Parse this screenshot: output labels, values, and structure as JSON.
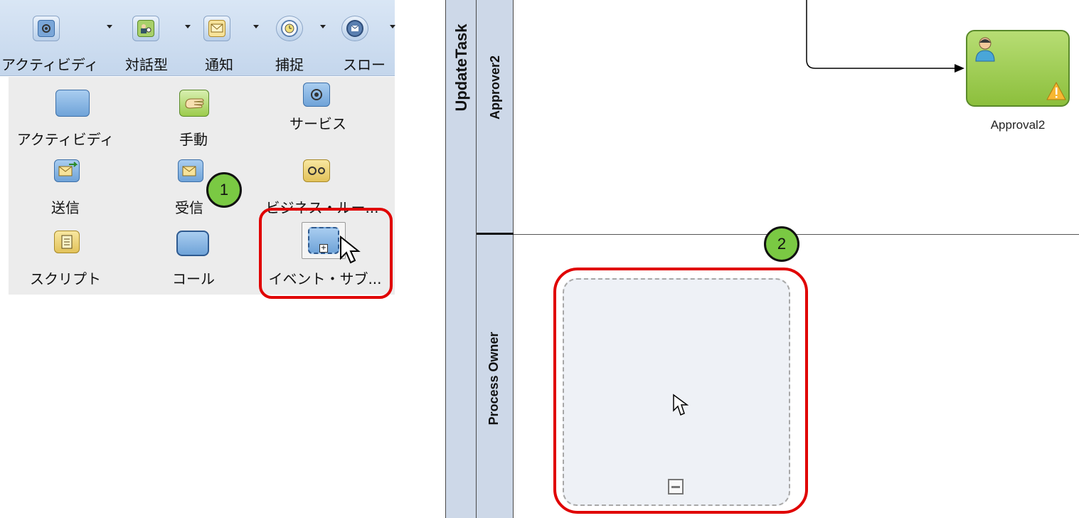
{
  "toolbar": {
    "categories": [
      {
        "label": "アクティビディ",
        "icon": "gear-icon"
      },
      {
        "label": "対話型",
        "icon": "people-icon"
      },
      {
        "label": "通知",
        "icon": "envelope-icon"
      },
      {
        "label": "捕捉",
        "icon": "clock-icon"
      },
      {
        "label": "スロー",
        "icon": "message-icon"
      }
    ]
  },
  "palette": {
    "items": [
      {
        "label": "アクティビディ",
        "icon": "activity-icon"
      },
      {
        "label": "手動",
        "icon": "hand-icon"
      },
      {
        "label": "サービス",
        "icon": "gear-icon"
      },
      {
        "label": "送信",
        "icon": "send-envelope-icon"
      },
      {
        "label": "受信",
        "icon": "receive-envelope-icon"
      },
      {
        "label": "ビジネス・ルー...",
        "icon": "business-rule-icon"
      },
      {
        "label": "スクリプト",
        "icon": "script-icon"
      },
      {
        "label": "コール",
        "icon": "call-icon"
      },
      {
        "label": "イベント・サブ...",
        "icon": "event-subprocess-icon"
      }
    ]
  },
  "callouts": {
    "one": "1",
    "two": "2"
  },
  "diagram": {
    "pool_name": "UpdateTask",
    "lanes": [
      {
        "name": "Approver2"
      },
      {
        "name": "Process Owner"
      }
    ],
    "task": {
      "label": "Approval2",
      "icon": "user-icon",
      "warning_icon": "warning-icon"
    },
    "subprocess": {
      "icon": "collapse-icon"
    }
  },
  "colors": {
    "highlight": "#e00000",
    "callout": "#7ac943",
    "task_fill": "#9ccc4c",
    "lane_header": "#cdd8e8"
  }
}
